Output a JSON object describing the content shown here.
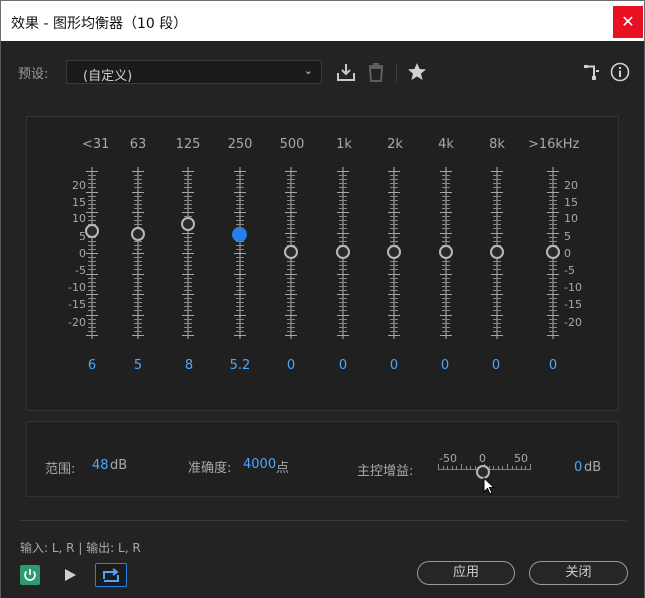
{
  "window": {
    "title": "效果 - 图形均衡器（10 段）",
    "close_glyph": "✕"
  },
  "preset": {
    "label": "预设:",
    "value": "(自定义)"
  },
  "toolbar_icons": [
    "save-preset-icon",
    "delete-preset-icon",
    "favorite-star-icon",
    "routing-icon",
    "info-icon"
  ],
  "eq": {
    "bands": [
      {
        "freq": "<31",
        "value": "6"
      },
      {
        "freq": "63",
        "value": "5"
      },
      {
        "freq": "125",
        "value": "8"
      },
      {
        "freq": "250",
        "value": "5.2"
      },
      {
        "freq": "500",
        "value": "0"
      },
      {
        "freq": "1k",
        "value": "0"
      },
      {
        "freq": "2k",
        "value": "0"
      },
      {
        "freq": "4k",
        "value": "0"
      },
      {
        "freq": "8k",
        "value": "0"
      },
      {
        "freq": ">16k",
        "value": "0"
      }
    ],
    "unit": "Hz",
    "db_scale": [
      "20",
      "15",
      "10",
      "5",
      "0",
      "-5",
      "-10",
      "-15",
      "-20"
    ],
    "active_band": "250"
  },
  "settings": {
    "range_label": "范围:",
    "range_value": "48",
    "range_unit": "dB",
    "accuracy_label": "准确度:",
    "accuracy_value": "4000",
    "accuracy_unit": "点",
    "master_gain_label": "主控增益:",
    "master_gain_scale": [
      "-50",
      "0",
      "50"
    ],
    "master_gain_value": "0",
    "master_gain_unit": "dB"
  },
  "footer": {
    "io_text": "输入: L, R | 输出: L, R",
    "apply_label": "应用",
    "close_label": "关闭"
  },
  "colors": {
    "accent": "#2680eb",
    "value_text": "#4ea6ff",
    "power_on": "#2d9b6f",
    "close": "#e81123"
  }
}
